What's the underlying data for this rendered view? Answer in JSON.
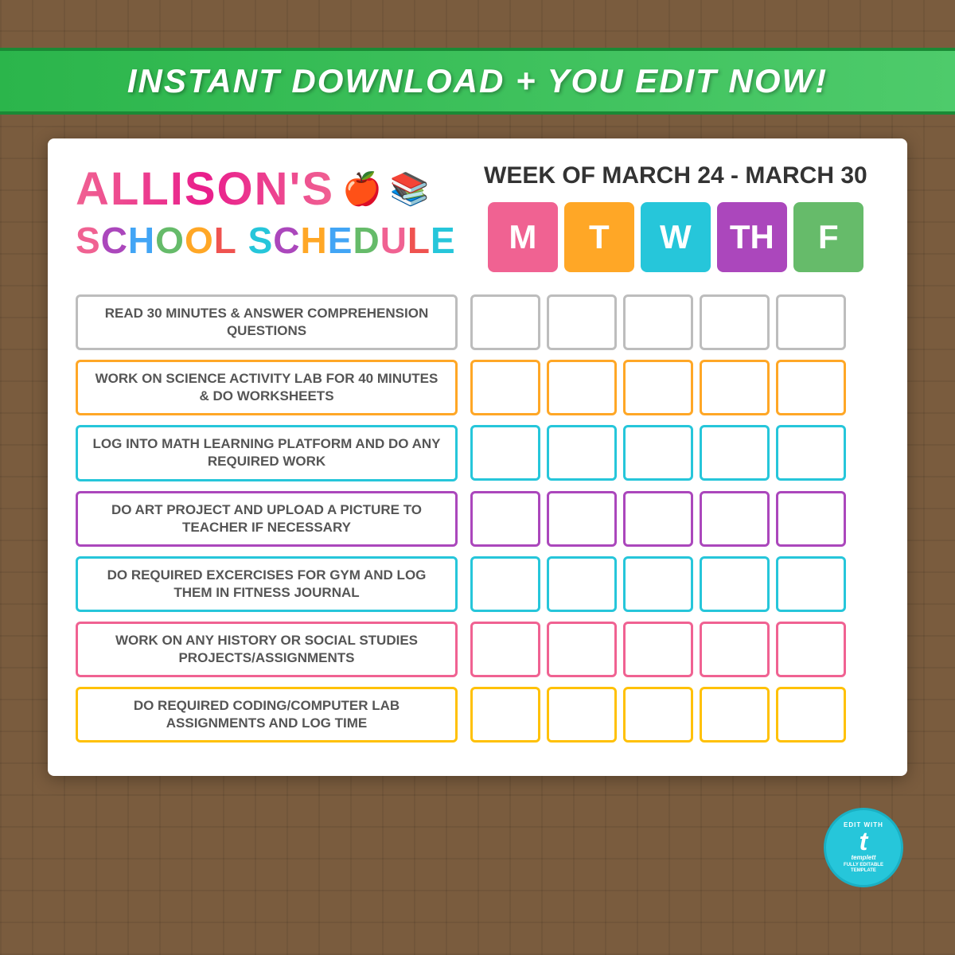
{
  "banner": {
    "text": "INSTANT DOWNLOAD + YOU EDIT NOW!"
  },
  "header": {
    "name": "ALLISON'S",
    "subtitle_school": "SCHOOL",
    "subtitle_schedule": "SCHEDULE",
    "week_label": "WEEK OF MARCH 24 - MARCH 30",
    "days": [
      {
        "id": "M",
        "label": "M",
        "color_class": "day-M"
      },
      {
        "id": "T",
        "label": "T",
        "color_class": "day-T"
      },
      {
        "id": "W",
        "label": "W",
        "color_class": "day-W"
      },
      {
        "id": "TH",
        "label": "TH",
        "color_class": "day-TH"
      },
      {
        "id": "F",
        "label": "F",
        "color_class": "day-F"
      }
    ]
  },
  "tasks": [
    {
      "id": 1,
      "text": "READ 30 MINUTES & ANSWER COMPREHENSION QUESTIONS",
      "color": "gray",
      "border_class": "task-label-gray",
      "cb_class": "cb-gray"
    },
    {
      "id": 2,
      "text": "WORK ON SCIENCE ACTIVITY LAB FOR 40 MINUTES & DO WORKSHEETS",
      "color": "orange",
      "border_class": "task-label-orange",
      "cb_class": "cb-orange"
    },
    {
      "id": 3,
      "text": "LOG INTO MATH LEARNING PLATFORM AND DO ANY REQUIRED WORK",
      "color": "teal",
      "border_class": "task-label-teal",
      "cb_class": "cb-teal"
    },
    {
      "id": 4,
      "text": "DO ART PROJECT AND UPLOAD A PICTURE TO TEACHER IF NECESSARY",
      "color": "purple",
      "border_class": "task-label-purple",
      "cb_class": "cb-purple"
    },
    {
      "id": 5,
      "text": "DO REQUIRED EXCERCISES FOR GYM AND LOG THEM IN FITNESS JOURNAL",
      "color": "cyan",
      "border_class": "task-label-cyan",
      "cb_class": "cb-cyan"
    },
    {
      "id": 6,
      "text": "WORK ON ANY HISTORY OR SOCIAL STUDIES PROJECTS/ASSIGNMENTS",
      "color": "pink",
      "border_class": "task-label-pink",
      "cb_class": "cb-pink"
    },
    {
      "id": 7,
      "text": "DO REQUIRED CODING/COMPUTER LAB ASSIGNMENTS AND LOG TIME",
      "color": "gold",
      "border_class": "task-label-gold",
      "cb_class": "cb-gold"
    }
  ],
  "badge": {
    "t_letter": "t",
    "line1": "EDIT WITH",
    "line2": "templett",
    "line3": "FULLY EDITABLE TEMPLATE"
  }
}
